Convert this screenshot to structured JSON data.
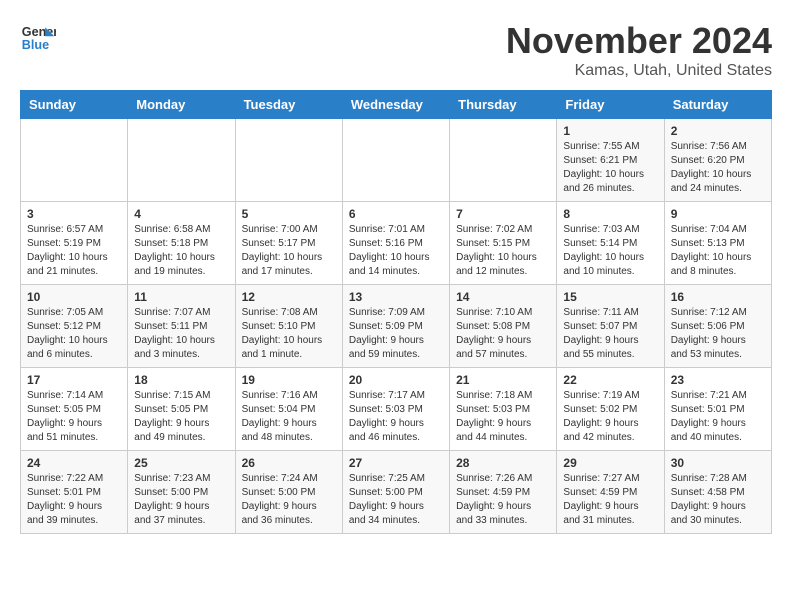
{
  "logo": {
    "line1": "General",
    "line2": "Blue"
  },
  "title": "November 2024",
  "subtitle": "Kamas, Utah, United States",
  "days_of_week": [
    "Sunday",
    "Monday",
    "Tuesday",
    "Wednesday",
    "Thursday",
    "Friday",
    "Saturday"
  ],
  "weeks": [
    [
      {
        "day": "",
        "info": ""
      },
      {
        "day": "",
        "info": ""
      },
      {
        "day": "",
        "info": ""
      },
      {
        "day": "",
        "info": ""
      },
      {
        "day": "",
        "info": ""
      },
      {
        "day": "1",
        "info": "Sunrise: 7:55 AM\nSunset: 6:21 PM\nDaylight: 10 hours\nand 26 minutes."
      },
      {
        "day": "2",
        "info": "Sunrise: 7:56 AM\nSunset: 6:20 PM\nDaylight: 10 hours\nand 24 minutes."
      }
    ],
    [
      {
        "day": "3",
        "info": "Sunrise: 6:57 AM\nSunset: 5:19 PM\nDaylight: 10 hours\nand 21 minutes."
      },
      {
        "day": "4",
        "info": "Sunrise: 6:58 AM\nSunset: 5:18 PM\nDaylight: 10 hours\nand 19 minutes."
      },
      {
        "day": "5",
        "info": "Sunrise: 7:00 AM\nSunset: 5:17 PM\nDaylight: 10 hours\nand 17 minutes."
      },
      {
        "day": "6",
        "info": "Sunrise: 7:01 AM\nSunset: 5:16 PM\nDaylight: 10 hours\nand 14 minutes."
      },
      {
        "day": "7",
        "info": "Sunrise: 7:02 AM\nSunset: 5:15 PM\nDaylight: 10 hours\nand 12 minutes."
      },
      {
        "day": "8",
        "info": "Sunrise: 7:03 AM\nSunset: 5:14 PM\nDaylight: 10 hours\nand 10 minutes."
      },
      {
        "day": "9",
        "info": "Sunrise: 7:04 AM\nSunset: 5:13 PM\nDaylight: 10 hours\nand 8 minutes."
      }
    ],
    [
      {
        "day": "10",
        "info": "Sunrise: 7:05 AM\nSunset: 5:12 PM\nDaylight: 10 hours\nand 6 minutes."
      },
      {
        "day": "11",
        "info": "Sunrise: 7:07 AM\nSunset: 5:11 PM\nDaylight: 10 hours\nand 3 minutes."
      },
      {
        "day": "12",
        "info": "Sunrise: 7:08 AM\nSunset: 5:10 PM\nDaylight: 10 hours\nand 1 minute."
      },
      {
        "day": "13",
        "info": "Sunrise: 7:09 AM\nSunset: 5:09 PM\nDaylight: 9 hours\nand 59 minutes."
      },
      {
        "day": "14",
        "info": "Sunrise: 7:10 AM\nSunset: 5:08 PM\nDaylight: 9 hours\nand 57 minutes."
      },
      {
        "day": "15",
        "info": "Sunrise: 7:11 AM\nSunset: 5:07 PM\nDaylight: 9 hours\nand 55 minutes."
      },
      {
        "day": "16",
        "info": "Sunrise: 7:12 AM\nSunset: 5:06 PM\nDaylight: 9 hours\nand 53 minutes."
      }
    ],
    [
      {
        "day": "17",
        "info": "Sunrise: 7:14 AM\nSunset: 5:05 PM\nDaylight: 9 hours\nand 51 minutes."
      },
      {
        "day": "18",
        "info": "Sunrise: 7:15 AM\nSunset: 5:05 PM\nDaylight: 9 hours\nand 49 minutes."
      },
      {
        "day": "19",
        "info": "Sunrise: 7:16 AM\nSunset: 5:04 PM\nDaylight: 9 hours\nand 48 minutes."
      },
      {
        "day": "20",
        "info": "Sunrise: 7:17 AM\nSunset: 5:03 PM\nDaylight: 9 hours\nand 46 minutes."
      },
      {
        "day": "21",
        "info": "Sunrise: 7:18 AM\nSunset: 5:03 PM\nDaylight: 9 hours\nand 44 minutes."
      },
      {
        "day": "22",
        "info": "Sunrise: 7:19 AM\nSunset: 5:02 PM\nDaylight: 9 hours\nand 42 minutes."
      },
      {
        "day": "23",
        "info": "Sunrise: 7:21 AM\nSunset: 5:01 PM\nDaylight: 9 hours\nand 40 minutes."
      }
    ],
    [
      {
        "day": "24",
        "info": "Sunrise: 7:22 AM\nSunset: 5:01 PM\nDaylight: 9 hours\nand 39 minutes."
      },
      {
        "day": "25",
        "info": "Sunrise: 7:23 AM\nSunset: 5:00 PM\nDaylight: 9 hours\nand 37 minutes."
      },
      {
        "day": "26",
        "info": "Sunrise: 7:24 AM\nSunset: 5:00 PM\nDaylight: 9 hours\nand 36 minutes."
      },
      {
        "day": "27",
        "info": "Sunrise: 7:25 AM\nSunset: 5:00 PM\nDaylight: 9 hours\nand 34 minutes."
      },
      {
        "day": "28",
        "info": "Sunrise: 7:26 AM\nSunset: 4:59 PM\nDaylight: 9 hours\nand 33 minutes."
      },
      {
        "day": "29",
        "info": "Sunrise: 7:27 AM\nSunset: 4:59 PM\nDaylight: 9 hours\nand 31 minutes."
      },
      {
        "day": "30",
        "info": "Sunrise: 7:28 AM\nSunset: 4:58 PM\nDaylight: 9 hours\nand 30 minutes."
      }
    ]
  ]
}
